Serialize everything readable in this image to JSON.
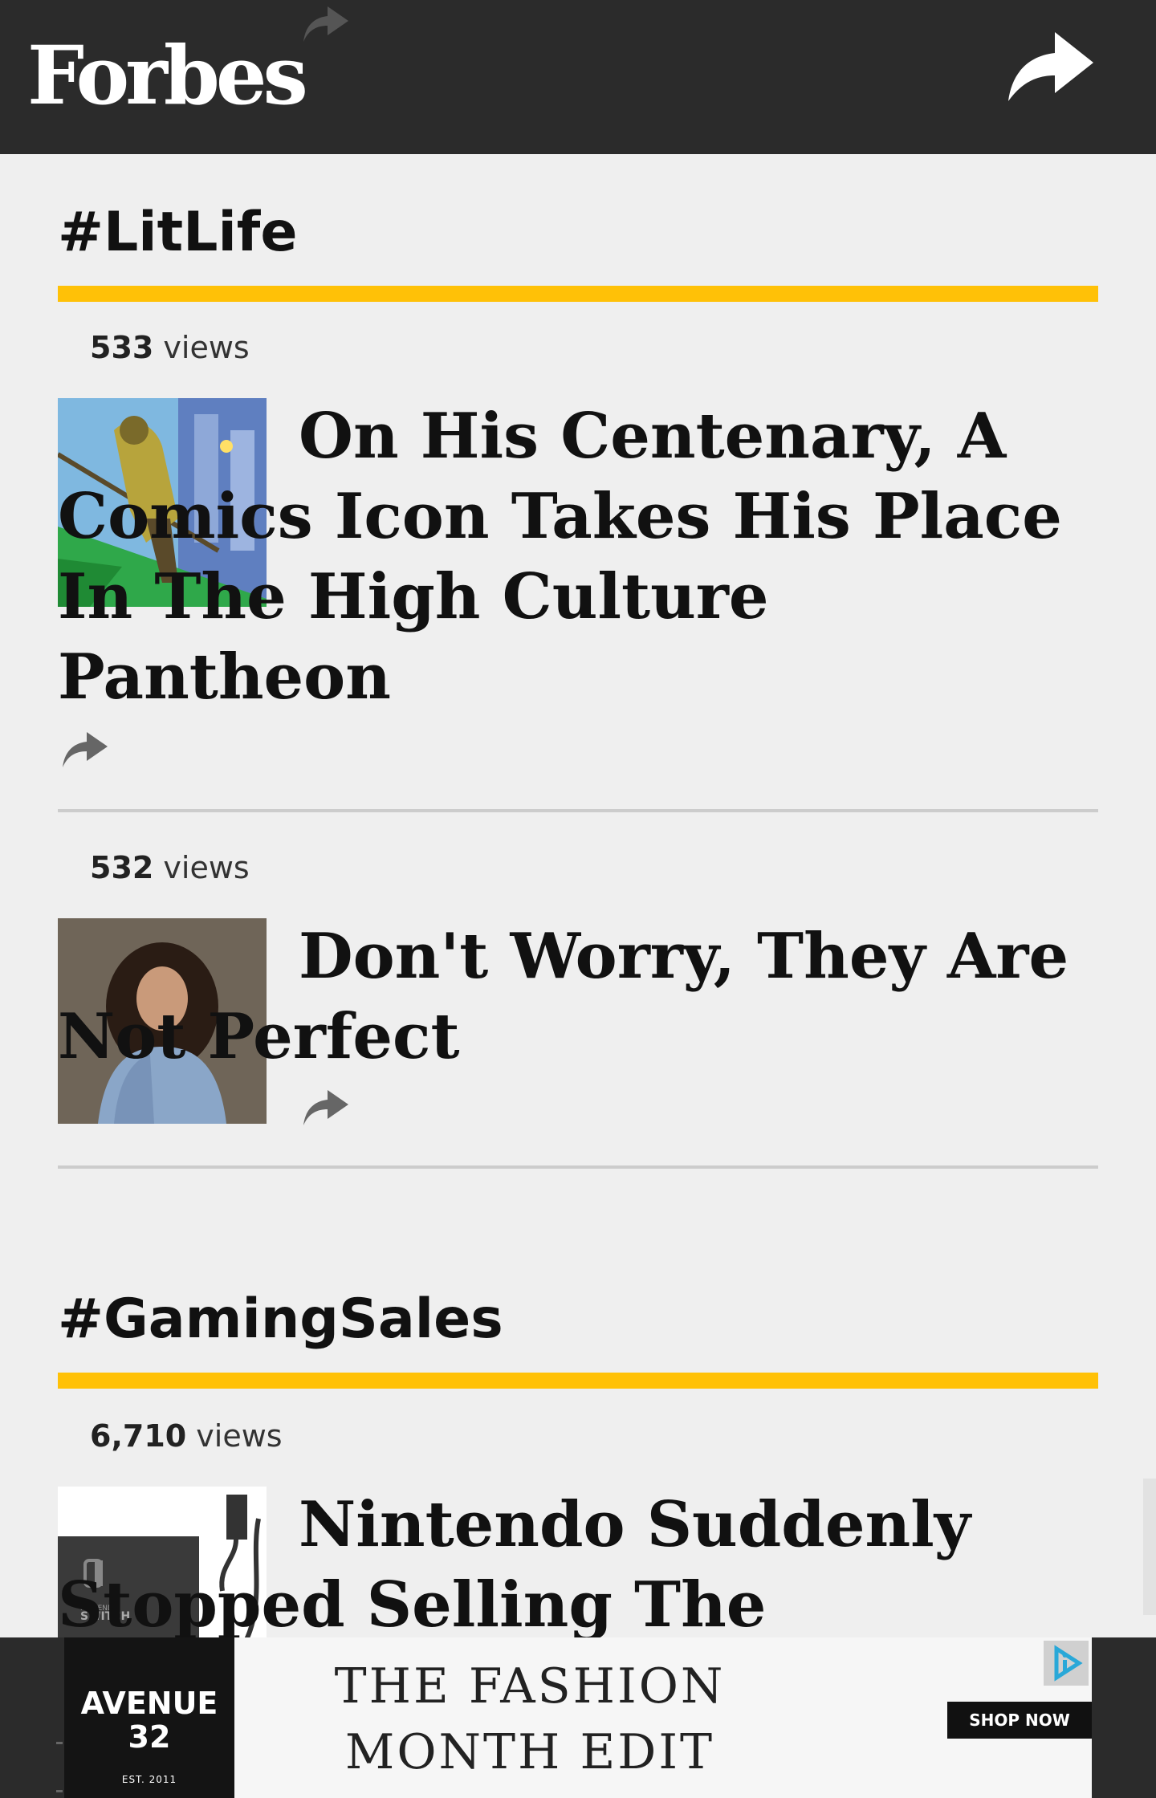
{
  "header": {
    "logo_text": "Forbes"
  },
  "sections": [
    {
      "title": "#LitLife",
      "articles": [
        {
          "views_count": "533",
          "views_label": "views",
          "headline": "On His Centenary, A Comics Icon Takes His Place In The High Culture Pantheon"
        },
        {
          "views_count": "532",
          "views_label": "views",
          "headline": "Don't Worry, They Are Not Perfect"
        }
      ]
    },
    {
      "title": "#GamingSales",
      "articles": [
        {
          "views_count": "6,710",
          "views_label": "views",
          "headline": "Nintendo Suddenly Stopped Selling The"
        }
      ]
    }
  ],
  "ad": {
    "brand_line1": "AVENUE",
    "brand_line2": "32",
    "brand_line3": "EST. 2011",
    "headline": "THE FASHION MONTH EDIT",
    "cta": "SHOP NOW",
    "thumb_label_small": "NINTENDO",
    "thumb_label_big": "SWITCH"
  },
  "colors": {
    "header_bg": "#2b2b2b",
    "accent": "#ffc107",
    "page_bg": "#efefef",
    "divider": "#cccccc"
  },
  "icons": [
    "share-arrow-icon",
    "ad-choices-icon"
  ]
}
